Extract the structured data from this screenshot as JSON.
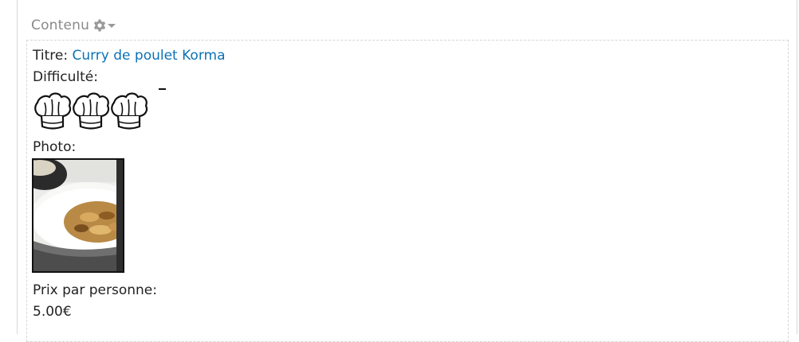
{
  "block": {
    "title": "Contenu",
    "settings_icon": "gear-icon"
  },
  "node": {
    "title_label": "Titre:",
    "title_value": "Curry de poulet Korma",
    "difficulty_label": "Difficulté:",
    "difficulty_hats": 3,
    "photo_label": "Photo:",
    "price_label": "Prix par personne:",
    "price_value": "5.00€"
  },
  "colors": {
    "link": "#0b72b5",
    "muted": "#8a8a8a",
    "text": "#222222"
  }
}
